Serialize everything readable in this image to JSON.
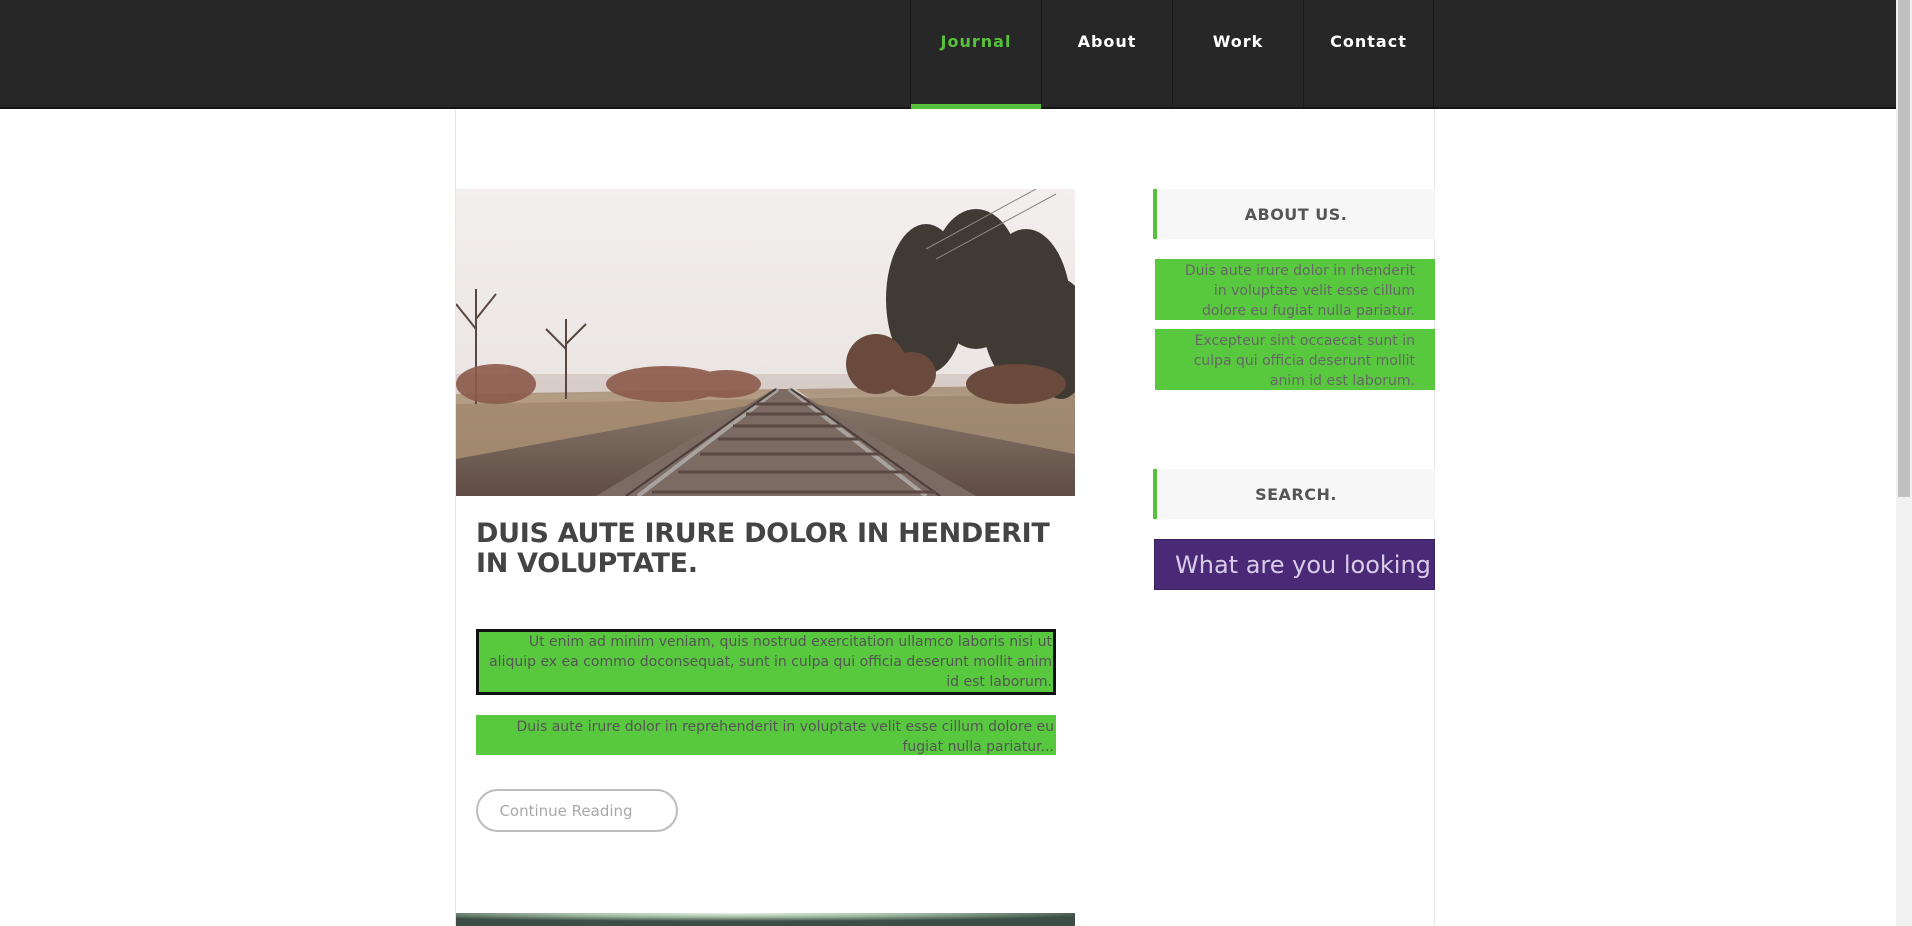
{
  "nav": {
    "items": [
      {
        "label": "Journal",
        "active": true
      },
      {
        "label": "About",
        "active": false
      },
      {
        "label": "Work",
        "active": false
      },
      {
        "label": "Contact",
        "active": false
      }
    ]
  },
  "post": {
    "title": "DUIS AUTE IRURE DOLOR IN HENDERIT IN VOLUPTATE.",
    "paragraphs": [
      "Ut enim ad minim veniam, quis nostrud exercitation ullamco laboris nisi ut aliquip ex ea commo doconsequat, sunt in culpa qui officia deserunt mollit anim id est laborum.",
      "Duis aute irure dolor in reprehenderit in voluptate velit esse cillum dolore eu fugiat nulla pariatur..."
    ],
    "continue_label": "Continue Reading"
  },
  "sidebar": {
    "about": {
      "heading": "ABOUT US.",
      "paragraphs": [
        "Duis aute irure dolor in rhenderit in voluptate velit esse cillum dolore eu fugiat nulla pariatur.",
        "Excepteur sint occaecat sunt in culpa qui officia deserunt mollit anim id est laborum."
      ]
    },
    "search": {
      "heading": "SEARCH.",
      "placeholder": "What are you looking"
    }
  },
  "colors": {
    "accent": "#58c13c",
    "header_bg": "#272727",
    "search_bg": "#4a2a77"
  }
}
